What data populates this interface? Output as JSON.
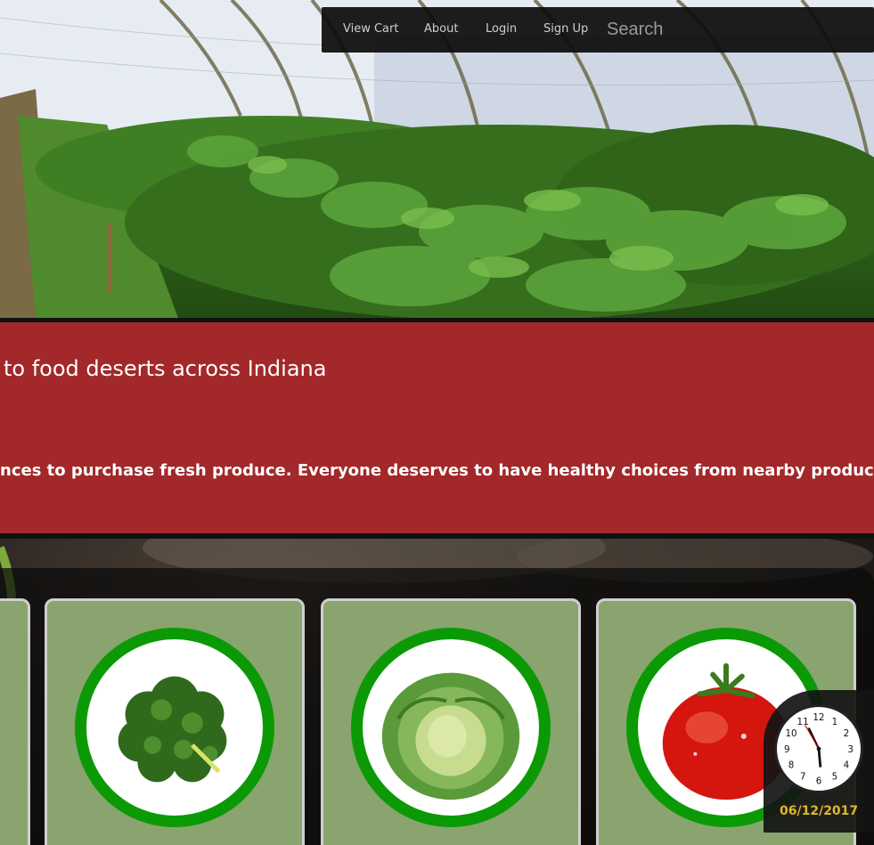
{
  "nav": {
    "view_cart": "View Cart",
    "about": "About",
    "login": "Login",
    "sign_up": "Sign Up",
    "search_placeholder": "Search"
  },
  "mission": {
    "title": "to food deserts across Indiana",
    "text": "nces to purchase fresh produce. Everyone deserves to have healthy choices from nearby producers."
  },
  "products": [
    {
      "image": "partial-produce"
    },
    {
      "image": "kale"
    },
    {
      "image": "cabbage"
    },
    {
      "image": "tomato"
    }
  ],
  "clock": {
    "numbers": [
      "12",
      "1",
      "2",
      "3",
      "4",
      "5",
      "6",
      "7",
      "8",
      "9",
      "10",
      "11"
    ],
    "date": "06/12/2017"
  },
  "colors": {
    "nav_bg": "#0c0c0c",
    "mission_bg": "#a2282a",
    "card_bg": "#8aa46f",
    "ring": "#0b9a05",
    "clock_date": "#e0b62a"
  }
}
